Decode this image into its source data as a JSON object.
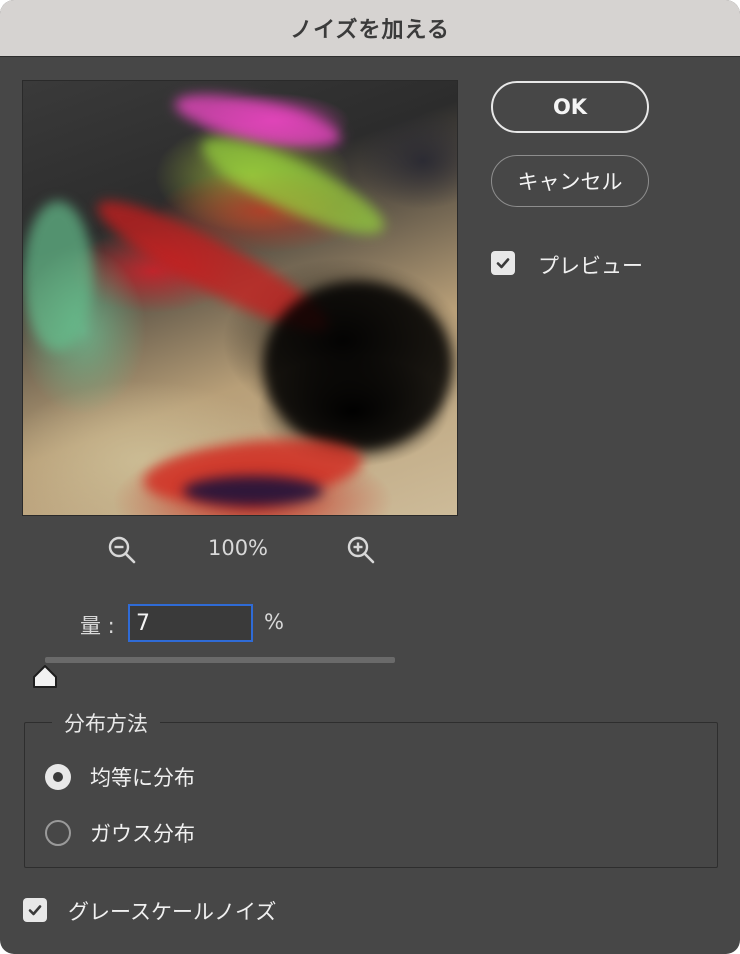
{
  "dialog": {
    "title": "ノイズを加える"
  },
  "buttons": {
    "ok_label": "OK",
    "cancel_label": "キャンセル"
  },
  "preview_option": {
    "label": "プレビュー",
    "checked": true
  },
  "zoom": {
    "value": "100%",
    "zoom_out_icon": "zoom-out-icon",
    "zoom_in_icon": "zoom-in-icon"
  },
  "amount": {
    "label": "量 :",
    "value": "7",
    "unit": "%",
    "slider_fraction": 0.0
  },
  "distribution": {
    "legend": "分布方法",
    "options": [
      {
        "label": "均等に分布",
        "selected": true
      },
      {
        "label": "ガウス分布",
        "selected": false
      }
    ]
  },
  "grayscale_option": {
    "label": "グレースケールノイズ",
    "checked": true
  },
  "colors": {
    "dialog_bg": "#474747",
    "titlebar_bg": "#d6d3d1",
    "focus_accent": "#2f6bd6"
  }
}
